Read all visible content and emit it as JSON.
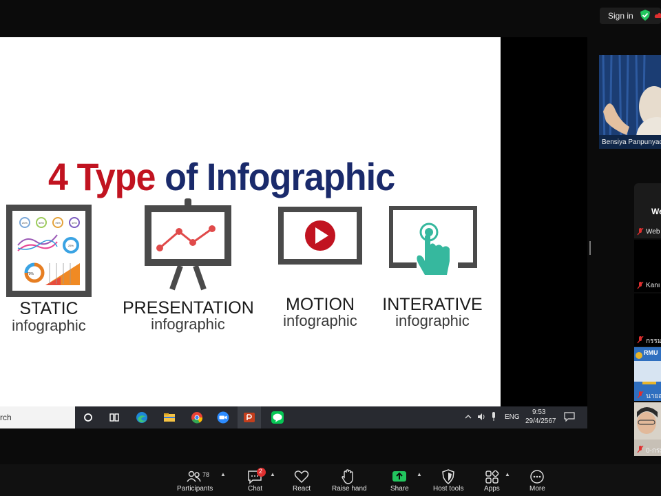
{
  "topbar": {
    "signin_label": "Sign in"
  },
  "slide": {
    "title_part1": "4 Type",
    "title_part2": "of Infographic",
    "types": [
      {
        "word": "STATIC",
        "sub": "infographic",
        "icon": "static-chart-icon"
      },
      {
        "word": "PRESENTATION",
        "sub": "infographic",
        "icon": "presentation-board-icon"
      },
      {
        "word": "MOTION",
        "sub": "infographic",
        "icon": "play-video-icon"
      },
      {
        "word": "INTERATIVE",
        "sub": "infographic",
        "icon": "touch-screen-icon"
      }
    ],
    "static_chart_labels": [
      "20%",
      "50%",
      "75%",
      "10%",
      "70%",
      "25%"
    ]
  },
  "taskbar": {
    "search_text": "rch",
    "language": "ENG",
    "time": "9:53",
    "date": "29/4/2567",
    "apps": [
      "search-circle-icon",
      "task-view-icon",
      "edge-icon",
      "file-explorer-icon",
      "chrome-icon",
      "zoom-icon",
      "powerpoint-icon",
      "line-icon"
    ]
  },
  "participants_panel": {
    "main_video_name": "Bensiya Panpunyac",
    "tiles": [
      {
        "name": "We",
        "label": "Web"
      },
      {
        "name": "Kanı"
      },
      {
        "name": "กรรม"
      },
      {
        "name": "นายอ",
        "badge": "RMU"
      },
      {
        "name": "0-กรม"
      }
    ]
  },
  "toolbar": {
    "participants_label": "Participants",
    "participants_count": "78",
    "chat_label": "Chat",
    "chat_badge": "2",
    "react_label": "React",
    "raise_hand_label": "Raise hand",
    "share_label": "Share",
    "host_tools_label": "Host tools",
    "apps_label": "Apps",
    "more_label": "More"
  },
  "colors": {
    "title_red": "#c11320",
    "title_blue": "#1a2a6b",
    "accent_green": "#22c55e",
    "badge_red": "#e02f2f",
    "teal": "#36b89e"
  }
}
